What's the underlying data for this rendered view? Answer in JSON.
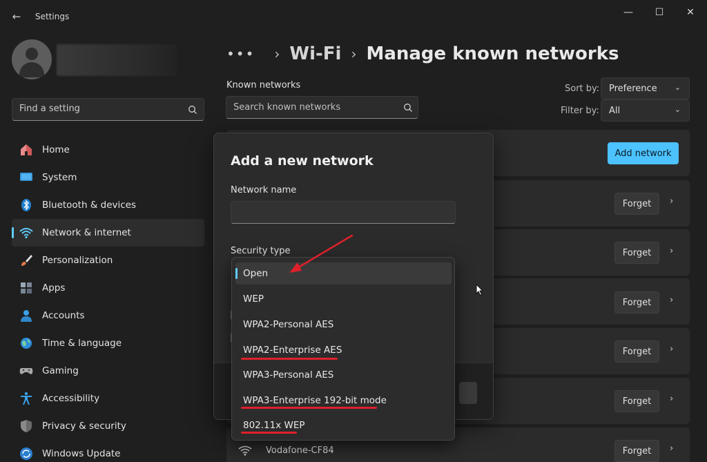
{
  "window": {
    "title": "Settings",
    "back_glyph": "←",
    "minimize_glyph": "—",
    "maximize_glyph": "☐",
    "close_glyph": "✕"
  },
  "sidebar": {
    "search_placeholder": "Find a setting",
    "items": [
      {
        "label": "Home",
        "icon": "home-icon"
      },
      {
        "label": "System",
        "icon": "system-icon"
      },
      {
        "label": "Bluetooth & devices",
        "icon": "bluetooth-icon"
      },
      {
        "label": "Network & internet",
        "icon": "wifi-icon",
        "selected": true
      },
      {
        "label": "Personalization",
        "icon": "brush-icon"
      },
      {
        "label": "Apps",
        "icon": "apps-icon"
      },
      {
        "label": "Accounts",
        "icon": "person-icon"
      },
      {
        "label": "Time & language",
        "icon": "globe-icon"
      },
      {
        "label": "Gaming",
        "icon": "gamepad-icon"
      },
      {
        "label": "Accessibility",
        "icon": "accessibility-icon"
      },
      {
        "label": "Privacy & security",
        "icon": "shield-icon"
      },
      {
        "label": "Windows Update",
        "icon": "update-icon"
      }
    ]
  },
  "breadcrumb": {
    "dots": "•••",
    "sep": "›",
    "parent": "Wi-Fi",
    "current": "Manage known networks"
  },
  "known": {
    "label": "Known networks",
    "search_placeholder": "Search known networks",
    "sort_label": "Sort by:",
    "sort_value": "Preference",
    "filter_label": "Filter by:",
    "filter_value": "All",
    "add_button": "Add network",
    "forget_label": "Forget",
    "chevron": "›",
    "last_network": "Vodafone-CF84"
  },
  "dialog": {
    "title": "Add a new network",
    "name_label": "Network name",
    "security_label": "Security type",
    "options": [
      {
        "label": "Open",
        "selected": true,
        "underlined": false
      },
      {
        "label": "WEP",
        "selected": false,
        "underlined": false
      },
      {
        "label": "WPA2-Personal AES",
        "selected": false,
        "underlined": false
      },
      {
        "label": "WPA2-Enterprise AES",
        "selected": false,
        "underlined": true
      },
      {
        "label": "WPA3-Personal AES",
        "selected": false,
        "underlined": false
      },
      {
        "label": "WPA3-Enterprise 192-bit mode",
        "selected": false,
        "underlined": true
      },
      {
        "label": "802.11x WEP",
        "selected": false,
        "underlined": true
      }
    ]
  },
  "colors": {
    "accent": "#60cdff",
    "primary_button": "#4cc2ff",
    "annotation_red": "#e0202a"
  }
}
